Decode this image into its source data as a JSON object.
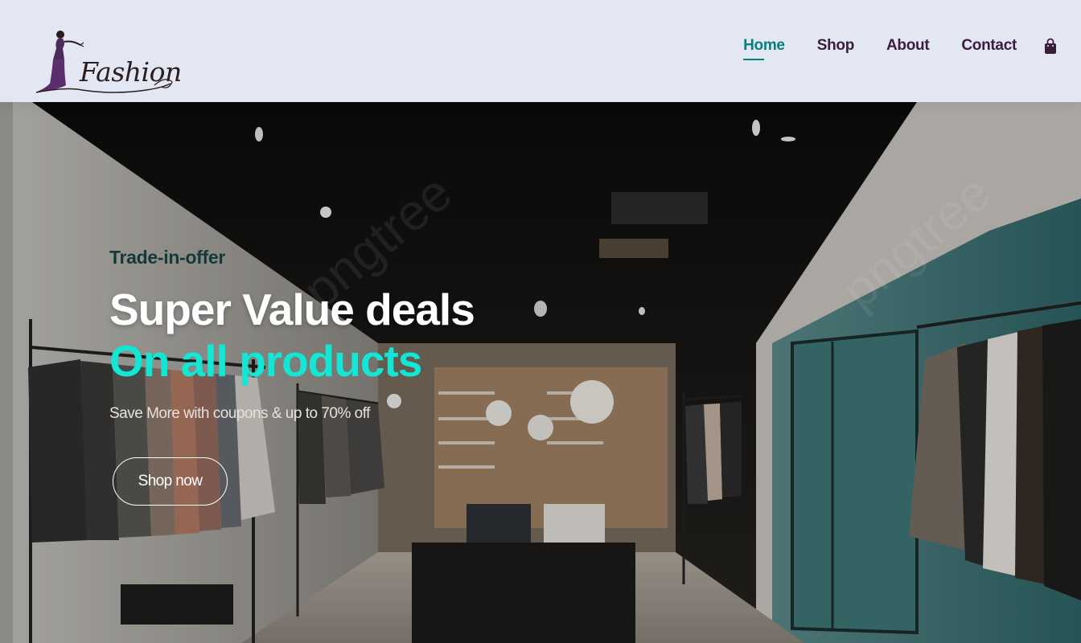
{
  "brand": {
    "logo_text": "Fashion"
  },
  "nav": {
    "items": [
      {
        "label": "Home",
        "active": true
      },
      {
        "label": "Shop",
        "active": false
      },
      {
        "label": "About",
        "active": false
      },
      {
        "label": "Contact",
        "active": false
      }
    ],
    "cart_icon": "shopping-bag-icon"
  },
  "hero": {
    "kicker": "Trade-in-offer",
    "title_line1": "Super Value deals",
    "title_line2": "On all products",
    "subtitle": "Save More with coupons & up to 70% off",
    "cta_label": "Shop now",
    "watermark": "pngtree"
  },
  "colors": {
    "header_bg": "#e3e6f3",
    "accent": "#088178",
    "nav_text": "#3b1f3a",
    "highlight": "#10e7d4"
  }
}
